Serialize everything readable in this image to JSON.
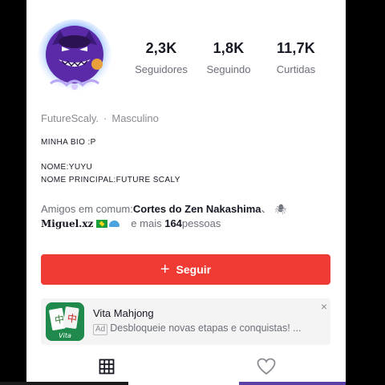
{
  "stats": [
    {
      "value": "2,3K",
      "label": "Seguidores"
    },
    {
      "value": "1,8K",
      "label": "Seguindo"
    },
    {
      "value": "11,7K",
      "label": "Curtidas"
    }
  ],
  "profile": {
    "name": "FutureScaly.",
    "separator": "·",
    "gender": "Masculino",
    "bio_lines": [
      "MINHA BIO :P",
      "NOME:YUYU",
      "NOME PRINCIPAL:FUTURE SCALY"
    ]
  },
  "mutual": {
    "prefix": "Amigos em comum:",
    "friend_1": "Cortes do Zen Nakashima",
    "friend_1_suffix": "、",
    "friend_2": "Miguel.xz",
    "more_prefix": "e mais ",
    "more_count": "164",
    "more_suffix": " pessoas"
  },
  "follow_button": {
    "icon": "+",
    "label": "Seguir"
  },
  "ad": {
    "title": "Vita Mahjong",
    "badge": "Ad",
    "description": "Desbloqueie novas etapas e conquistas! ...",
    "icon_text": "Vita",
    "close_icon": "×"
  },
  "tabs": [
    {
      "icon": "grid-icon",
      "active": true
    },
    {
      "icon": "heart-icon",
      "active": false
    }
  ],
  "colors": {
    "accent": "#ef3b33",
    "text": "#161823",
    "muted": "#6b6f78",
    "ad_background": "#f4f4f5"
  }
}
